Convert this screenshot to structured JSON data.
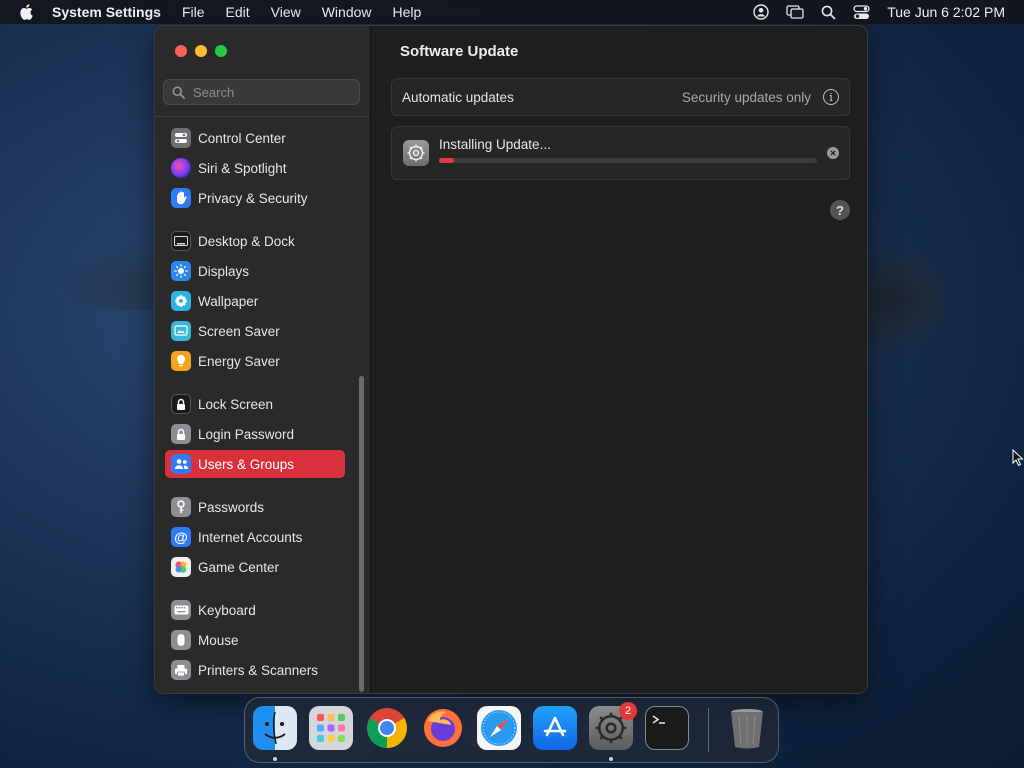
{
  "menubar": {
    "app_name": "System Settings",
    "items": [
      "File",
      "Edit",
      "View",
      "Window",
      "Help"
    ],
    "clock": "Tue Jun 6  2:02 PM",
    "status_icons": [
      "user-icon",
      "screen-mirroring-icon",
      "spotlight-search-icon",
      "control-center-icon"
    ]
  },
  "sidebar": {
    "search_placeholder": "Search",
    "items": [
      {
        "label": "Control Center",
        "icon": "control-center-icon",
        "color": "#6e6e73"
      },
      {
        "label": "Siri & Spotlight",
        "icon": "siri-icon",
        "color": "#8a3ab9"
      },
      {
        "label": "Privacy & Security",
        "icon": "hand-icon",
        "color": "#2f7bf5"
      },
      {
        "label": "Desktop & Dock",
        "icon": "dock-icon",
        "color": "#1b1b1d"
      },
      {
        "label": "Displays",
        "icon": "sun-icon",
        "color": "#2d86f0"
      },
      {
        "label": "Wallpaper",
        "icon": "flower-icon",
        "color": "#2fb3e6"
      },
      {
        "label": "Screen Saver",
        "icon": "screen-saver-icon",
        "color": "#38b7d6"
      },
      {
        "label": "Energy Saver",
        "icon": "lightbulb-icon",
        "color": "#f2a420"
      },
      {
        "label": "Lock Screen",
        "icon": "lock-icon",
        "color": "#1b1b1d"
      },
      {
        "label": "Login Password",
        "icon": "lock-icon",
        "color": "#8e8e93"
      },
      {
        "label": "Users & Groups",
        "icon": "users-icon",
        "color": "#2f7bf5",
        "active": true
      },
      {
        "label": "Passwords",
        "icon": "key-icon",
        "color": "#8e8e93"
      },
      {
        "label": "Internet Accounts",
        "icon": "at-icon",
        "color": "#2f7bf5"
      },
      {
        "label": "Game Center",
        "icon": "game-center-icon",
        "color": "#f0f0f0"
      },
      {
        "label": "Keyboard",
        "icon": "keyboard-icon",
        "color": "#8e8e93"
      },
      {
        "label": "Mouse",
        "icon": "mouse-icon",
        "color": "#8e8e93"
      },
      {
        "label": "Printers & Scanners",
        "icon": "printer-icon",
        "color": "#8e8e93"
      }
    ]
  },
  "main": {
    "title": "Software Update",
    "automatic_updates": {
      "label": "Automatic updates",
      "value": "Security updates only"
    },
    "install": {
      "label": "Installing Update...",
      "progress": 0.04
    },
    "help_label": "?"
  },
  "dock": {
    "apps": [
      "Finder",
      "Launchpad",
      "Google Chrome",
      "Firefox",
      "Safari",
      "App Store",
      "System Settings",
      "Terminal"
    ],
    "badge_count": "2",
    "trash": "Trash"
  },
  "colors": {
    "accent": "#d9303d",
    "progress": "#e23d47"
  }
}
